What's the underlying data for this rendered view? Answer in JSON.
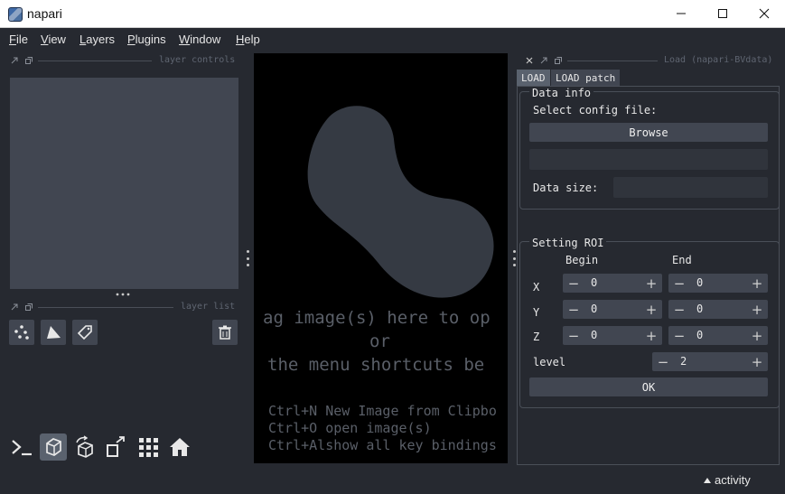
{
  "window": {
    "title": "napari"
  },
  "menubar": {
    "items": [
      "File",
      "View",
      "Layers",
      "Plugins",
      "Window",
      "Help"
    ]
  },
  "layer_controls": {
    "title": "layer controls"
  },
  "layer_list": {
    "title": "layer list"
  },
  "canvas": {
    "welcome": {
      "line1": "ag image(s) here to op",
      "line2": "or",
      "line3": "the menu shortcuts be"
    },
    "shortcuts": [
      "Ctrl+N New Image from Clipbo",
      "Ctrl+O open image(s)",
      "Ctrl+Alshow all key bindings"
    ]
  },
  "plugin_dock": {
    "title": "Load (napari-BVdata)",
    "tabs": [
      "LOAD",
      "LOAD patch"
    ],
    "data_info": {
      "title": "Data info",
      "select_label": "Select config file:",
      "browse_label": "Browse",
      "path_value": "",
      "data_size_label": "Data size:",
      "data_size_value": ""
    },
    "roi": {
      "title": "Setting ROI",
      "begin_label": "Begin",
      "end_label": "End",
      "rows": [
        {
          "axis": "X",
          "begin": "0",
          "end": "0"
        },
        {
          "axis": "Y",
          "begin": "0",
          "end": "0"
        },
        {
          "axis": "Z",
          "begin": "0",
          "end": "0"
        }
      ],
      "level_label": "level",
      "level_value": "2",
      "ok_label": "OK"
    }
  },
  "statusbar": {
    "activity_label": "activity"
  },
  "colors": {
    "background": "#262930",
    "panel": "#414651",
    "canvas": "#000000",
    "logo": "#353a43"
  }
}
